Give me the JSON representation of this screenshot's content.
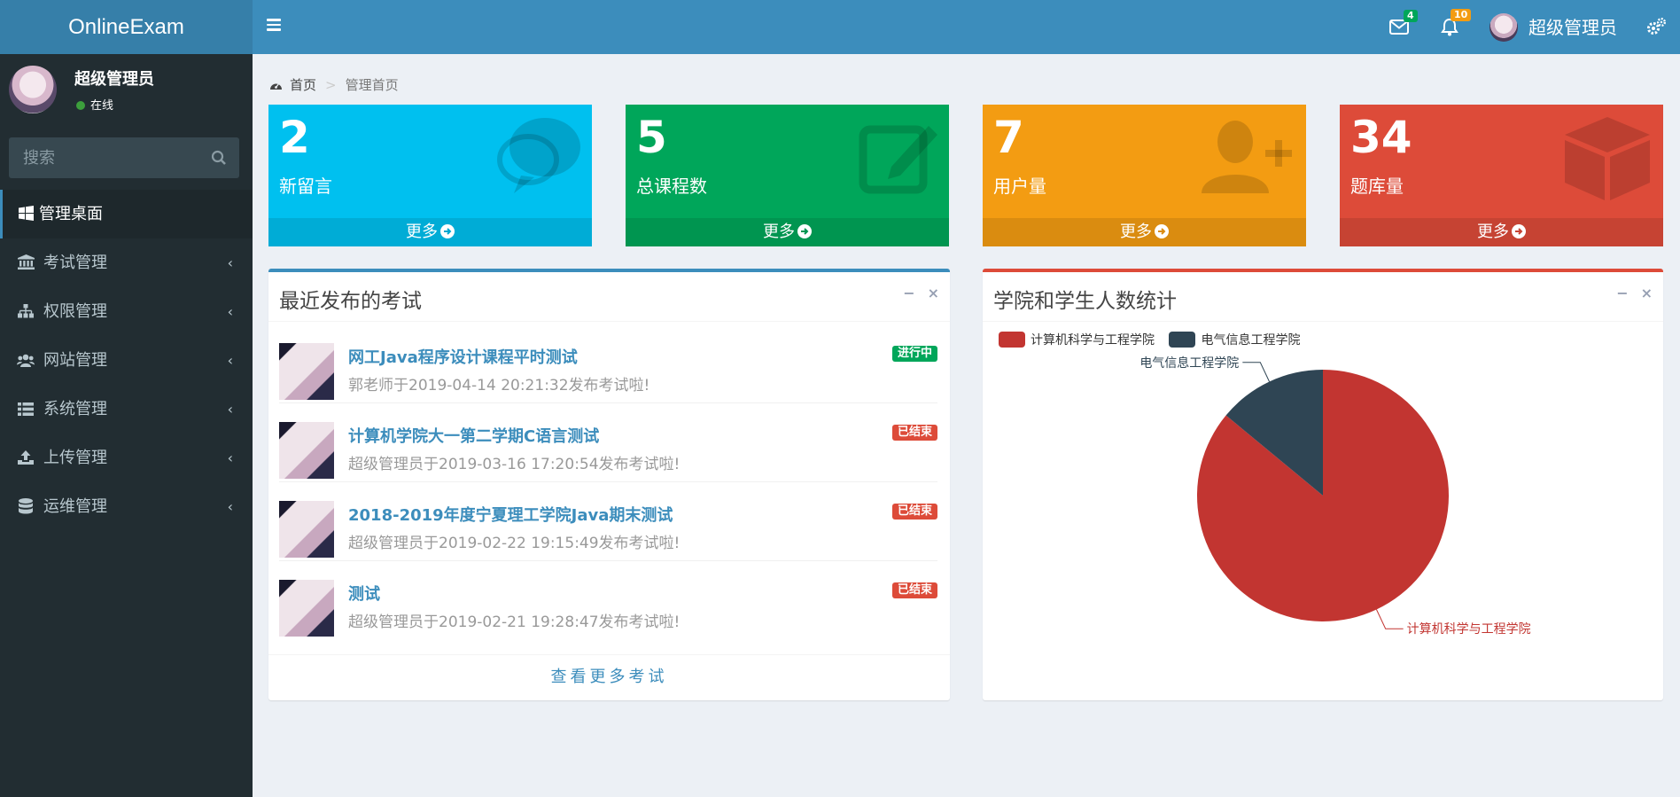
{
  "app": {
    "logo": "OnlineExam"
  },
  "header": {
    "mail_badge": "4",
    "bell_badge": "10",
    "user_name": "超级管理员"
  },
  "sidebar": {
    "user_name": "超级管理员",
    "status": "在线",
    "search_placeholder": "搜索",
    "items": [
      {
        "label": "管理桌面",
        "icon": "windows-icon",
        "active": true
      },
      {
        "label": "考试管理",
        "icon": "bank-icon"
      },
      {
        "label": "权限管理",
        "icon": "sitemap-icon"
      },
      {
        "label": "网站管理",
        "icon": "users-icon"
      },
      {
        "label": "系统管理",
        "icon": "list-icon"
      },
      {
        "label": "上传管理",
        "icon": "upload-icon"
      },
      {
        "label": "运维管理",
        "icon": "database-icon"
      }
    ]
  },
  "breadcrumb": {
    "home": "首页",
    "current": "管理首页"
  },
  "stats": [
    {
      "value": "2",
      "label": "新留言",
      "more": "更多",
      "color": "#00c0ef",
      "icon": "comments-icon"
    },
    {
      "value": "5",
      "label": "总课程数",
      "more": "更多",
      "color": "#00a65a",
      "icon": "edit-icon"
    },
    {
      "value": "7",
      "label": "用户量",
      "more": "更多",
      "color": "#f39c12",
      "icon": "user-plus-icon"
    },
    {
      "value": "34",
      "label": "题库量",
      "more": "更多",
      "color": "#dd4b39",
      "icon": "cube-icon"
    }
  ],
  "exams_panel": {
    "title": "最近发布的考试",
    "more": "查看更多考试",
    "items": [
      {
        "title": "网工Java程序设计课程平时测试",
        "desc": "郭老师于2019-04-14 20:21:32发布考试啦!",
        "tag": "进行中",
        "tag_color": "#00a65a"
      },
      {
        "title": "计算机学院大一第二学期C语言测试",
        "desc": "超级管理员于2019-03-16 17:20:54发布考试啦!",
        "tag": "已结束",
        "tag_color": "#dd4b39"
      },
      {
        "title": "2018-2019年度宁夏理工学院Java期末测试",
        "desc": "超级管理员于2019-02-22 19:15:49发布考试啦!",
        "tag": "已结束",
        "tag_color": "#dd4b39"
      },
      {
        "title": "测试",
        "desc": "超级管理员于2019-02-21 19:28:47发布考试啦!",
        "tag": "已结束",
        "tag_color": "#dd4b39"
      }
    ]
  },
  "chart_panel": {
    "title": "学院和学生人数统计"
  },
  "chart_data": {
    "type": "pie",
    "title": "",
    "series": [
      {
        "name": "计算机科学与工程学院",
        "value": 86,
        "color": "#c23531"
      },
      {
        "name": "电气信息工程学院",
        "value": 14,
        "color": "#2f4554"
      }
    ],
    "legend": "top-left"
  }
}
